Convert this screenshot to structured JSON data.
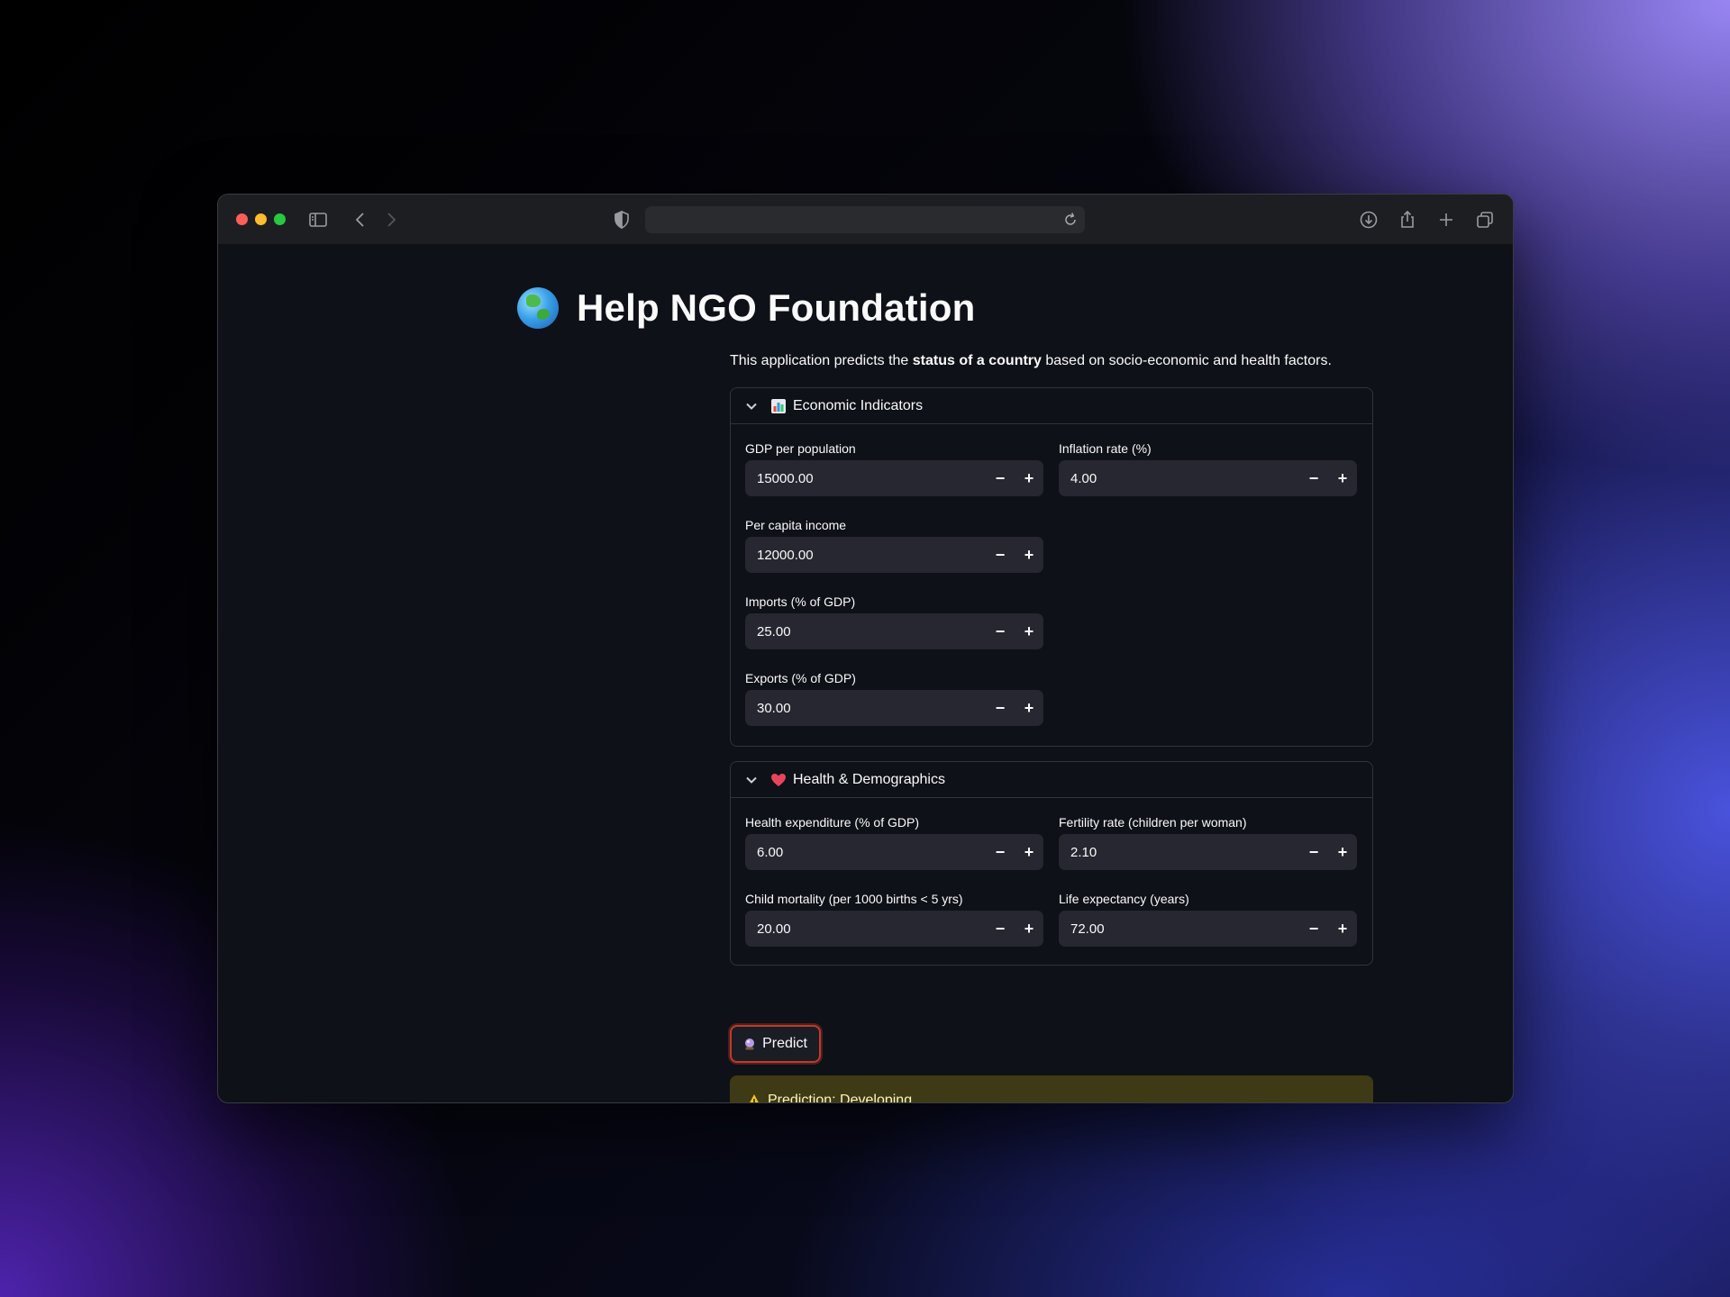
{
  "browser": {
    "url": "",
    "icons": [
      "sidebar-icon",
      "back-icon",
      "forward-icon",
      "shield-icon",
      "reload-icon",
      "download-icon",
      "share-icon",
      "new-tab-icon",
      "tabs-overview-icon"
    ]
  },
  "app": {
    "title": "Help NGO Foundation",
    "title_icon": "globe-icon",
    "intro_prefix": "This application predicts the ",
    "intro_bold": "status of a country",
    "intro_suffix": " based on socio-economic and health factors."
  },
  "economic": {
    "header": "Economic Indicators",
    "icon": "bar-chart-icon",
    "fields": [
      {
        "label": "GDP per population",
        "value": "15000.00"
      },
      {
        "label": "Inflation rate (%)",
        "value": "4.00"
      },
      {
        "label": "Per capita income",
        "value": "12000.00"
      },
      {
        "label": "Imports (% of GDP)",
        "value": "25.00"
      },
      {
        "label": "Exports (% of GDP)",
        "value": "30.00"
      }
    ]
  },
  "health": {
    "header": "Health & Demographics",
    "icon": "heart-icon",
    "fields": [
      {
        "label": "Health expenditure (% of GDP)",
        "value": "6.00"
      },
      {
        "label": "Fertility rate (children per woman)",
        "value": "2.10"
      },
      {
        "label": "Child mortality (per 1000 births < 5 yrs)",
        "value": "20.00"
      },
      {
        "label": "Life expectancy (years)",
        "value": "72.00"
      }
    ]
  },
  "stepper": {
    "minus": "−",
    "plus": "+"
  },
  "predict": {
    "label": "Predict",
    "icon": "crystal-ball-icon"
  },
  "result": {
    "text": "Prediction: Developing",
    "icon": "warning-icon"
  },
  "colors": {
    "app_bg": "#0e1117",
    "input_bg": "#262730",
    "accent_red": "#c0392b",
    "warning_bg": "#3e3a16",
    "warning_text": "#fff5b8"
  }
}
